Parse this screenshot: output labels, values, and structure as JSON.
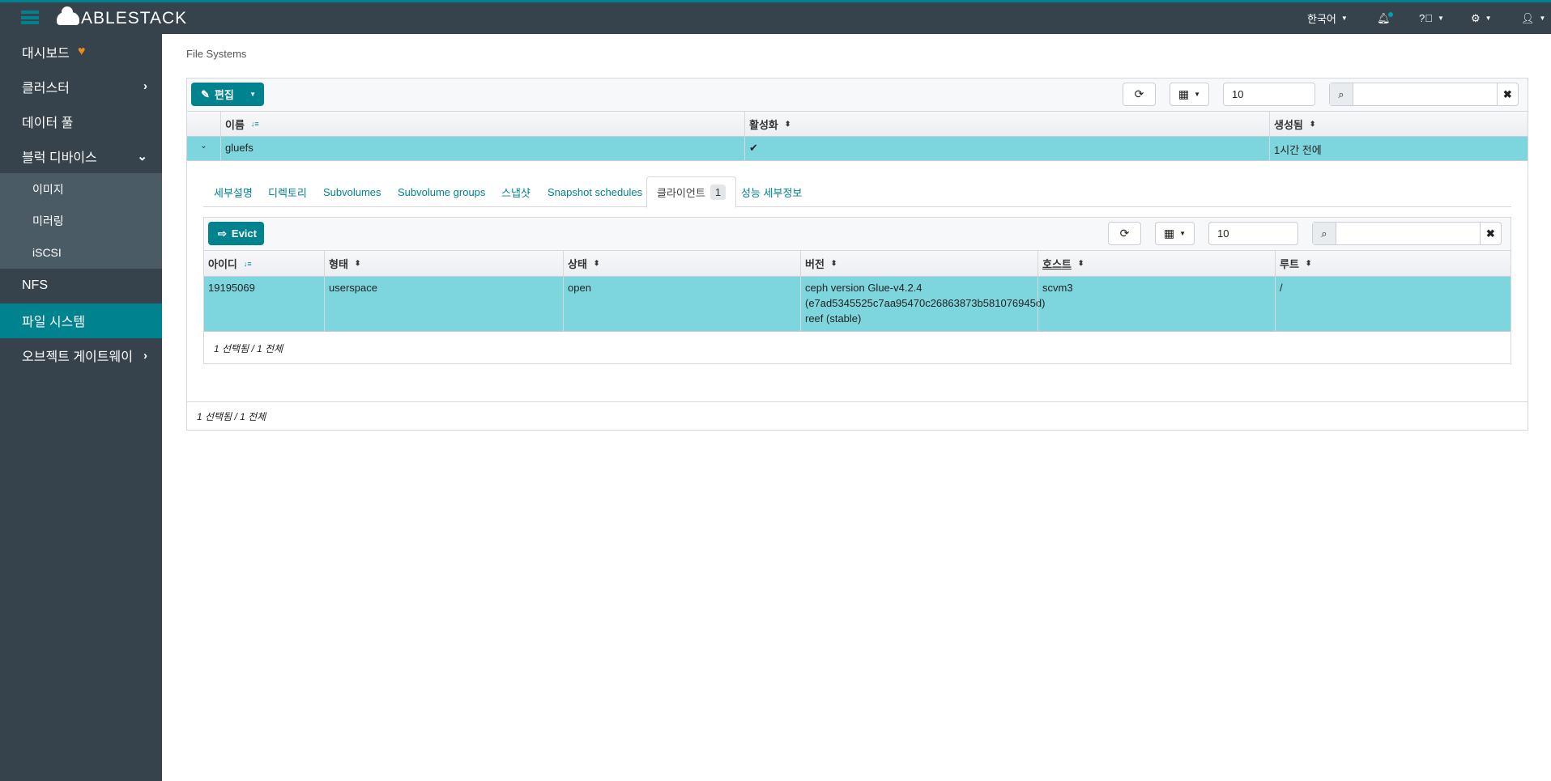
{
  "header": {
    "brand": "ABLESTACK",
    "language": "한국어"
  },
  "sidebar": {
    "items": [
      {
        "label": "대시보드"
      },
      {
        "label": "클러스터"
      },
      {
        "label": "데이터 풀"
      },
      {
        "label": "블럭 디바이스"
      },
      {
        "label": "이미지"
      },
      {
        "label": "미러링"
      },
      {
        "label": "iSCSI"
      },
      {
        "label": "NFS"
      },
      {
        "label": "파일 시스템"
      },
      {
        "label": "오브젝트 게이트웨이"
      }
    ]
  },
  "breadcrumb": "File Systems",
  "fs_table": {
    "edit_label": "편집",
    "page_size": "10",
    "search_value": "",
    "columns": [
      "이름",
      "활성화",
      "생성됨"
    ],
    "rows": [
      {
        "name": "gluefs",
        "enabled": "✔",
        "created": "1시간 전에"
      }
    ],
    "footer": "1 선택됨 / 1 전체"
  },
  "detail_tabs": [
    {
      "label": "세부설명"
    },
    {
      "label": "디렉토리"
    },
    {
      "label": "Subvolumes"
    },
    {
      "label": "Subvolume groups"
    },
    {
      "label": "스냅샷"
    },
    {
      "label": "Snapshot schedules"
    },
    {
      "label": "클라이언트",
      "badge": "1"
    },
    {
      "label": "성능 세부정보"
    }
  ],
  "clients_table": {
    "evict_label": "Evict",
    "page_size": "10",
    "search_value": "",
    "columns": [
      "아이디",
      "형태",
      "상태",
      "버전",
      "호스트",
      "루트"
    ],
    "rows": [
      {
        "id": "19195069",
        "type": "userspace",
        "state": "open",
        "version_lines": [
          "ceph version Glue-v4.2.4",
          "(e7ad5345525c7aa95470c26863873b581076945d)",
          "reef (stable)"
        ],
        "host": "scvm3",
        "root": "/"
      }
    ],
    "footer": "1 선택됨 / 1 전체"
  }
}
